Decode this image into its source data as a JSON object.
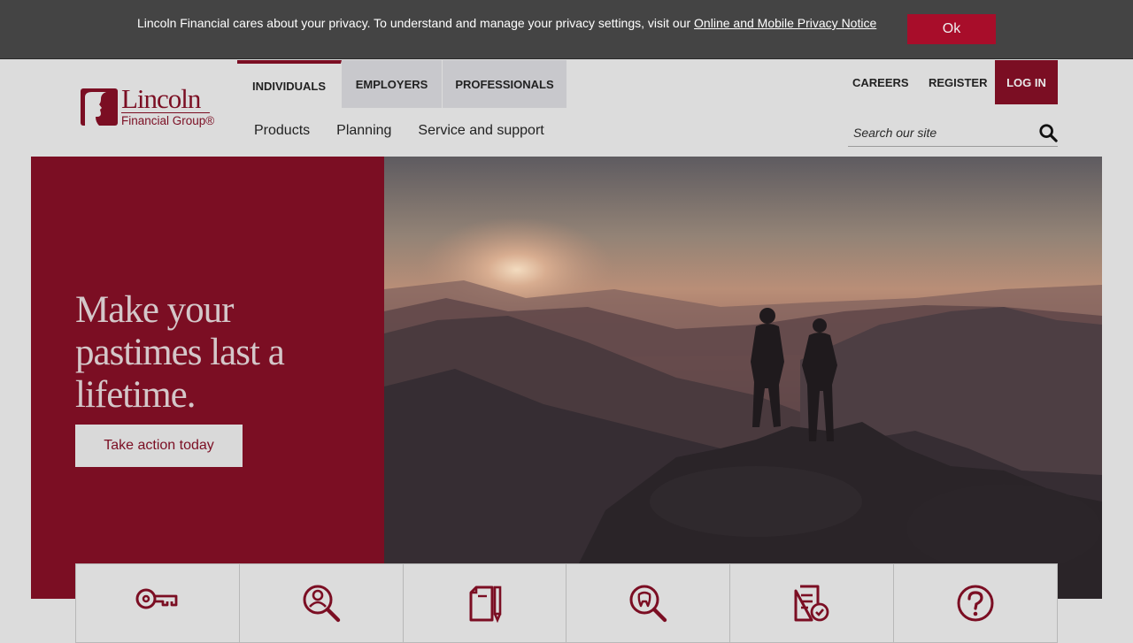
{
  "colors": {
    "brand": "#7b0e23",
    "cookie_bar": "#444444",
    "ok_button": "#a80d2a",
    "page_bg": "#dcdcdc"
  },
  "cookie_banner": {
    "text": "Lincoln Financial cares about your privacy. To understand and manage your privacy settings, visit our ",
    "link": "Online and Mobile Privacy Notice",
    "ok_label": "Ok"
  },
  "logo": {
    "name": "Lincoln",
    "sub": "Financial Group®"
  },
  "tabs": [
    {
      "label": "INDIVIDUALS",
      "active": true
    },
    {
      "label": "EMPLOYERS"
    },
    {
      "label": "PROFESSIONALS"
    }
  ],
  "subnav": [
    "Products",
    "Planning",
    "Service and support"
  ],
  "utility": {
    "careers": "CAREERS",
    "register": "REGISTER",
    "login": "LOG IN"
  },
  "search": {
    "placeholder": "Search our site",
    "icon": "search-icon"
  },
  "hero": {
    "title": "Make your pastimes last a lifetime.",
    "cta": "Take action today"
  },
  "tiles": [
    {
      "icon": "key-icon"
    },
    {
      "icon": "find-advisor-icon"
    },
    {
      "icon": "forms-icon"
    },
    {
      "icon": "dental-search-icon"
    },
    {
      "icon": "claims-document-icon"
    },
    {
      "icon": "help-icon"
    }
  ]
}
